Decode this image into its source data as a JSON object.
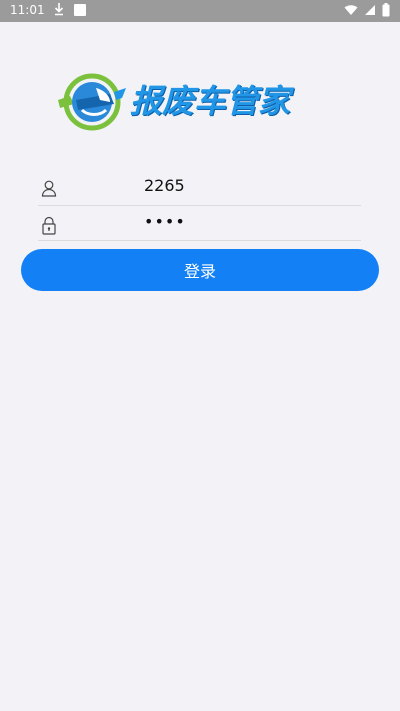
{
  "status_bar": {
    "time": "11:01",
    "download_icon": "download-icon",
    "wifi_icon": "wifi-icon",
    "battery_icon": "battery-icon"
  },
  "logo": {
    "text": "报废车管家",
    "icon": "wrench-car-logo-icon",
    "colors": {
      "blue": "#2196e6",
      "green": "#7cc13e"
    }
  },
  "form": {
    "username": {
      "value": "2265",
      "icon": "user-icon"
    },
    "password": {
      "value": "••••",
      "icon": "lock-icon"
    },
    "login_label": "登录"
  },
  "colors": {
    "primary": "#1380f5",
    "background": "#f3f3f7"
  }
}
